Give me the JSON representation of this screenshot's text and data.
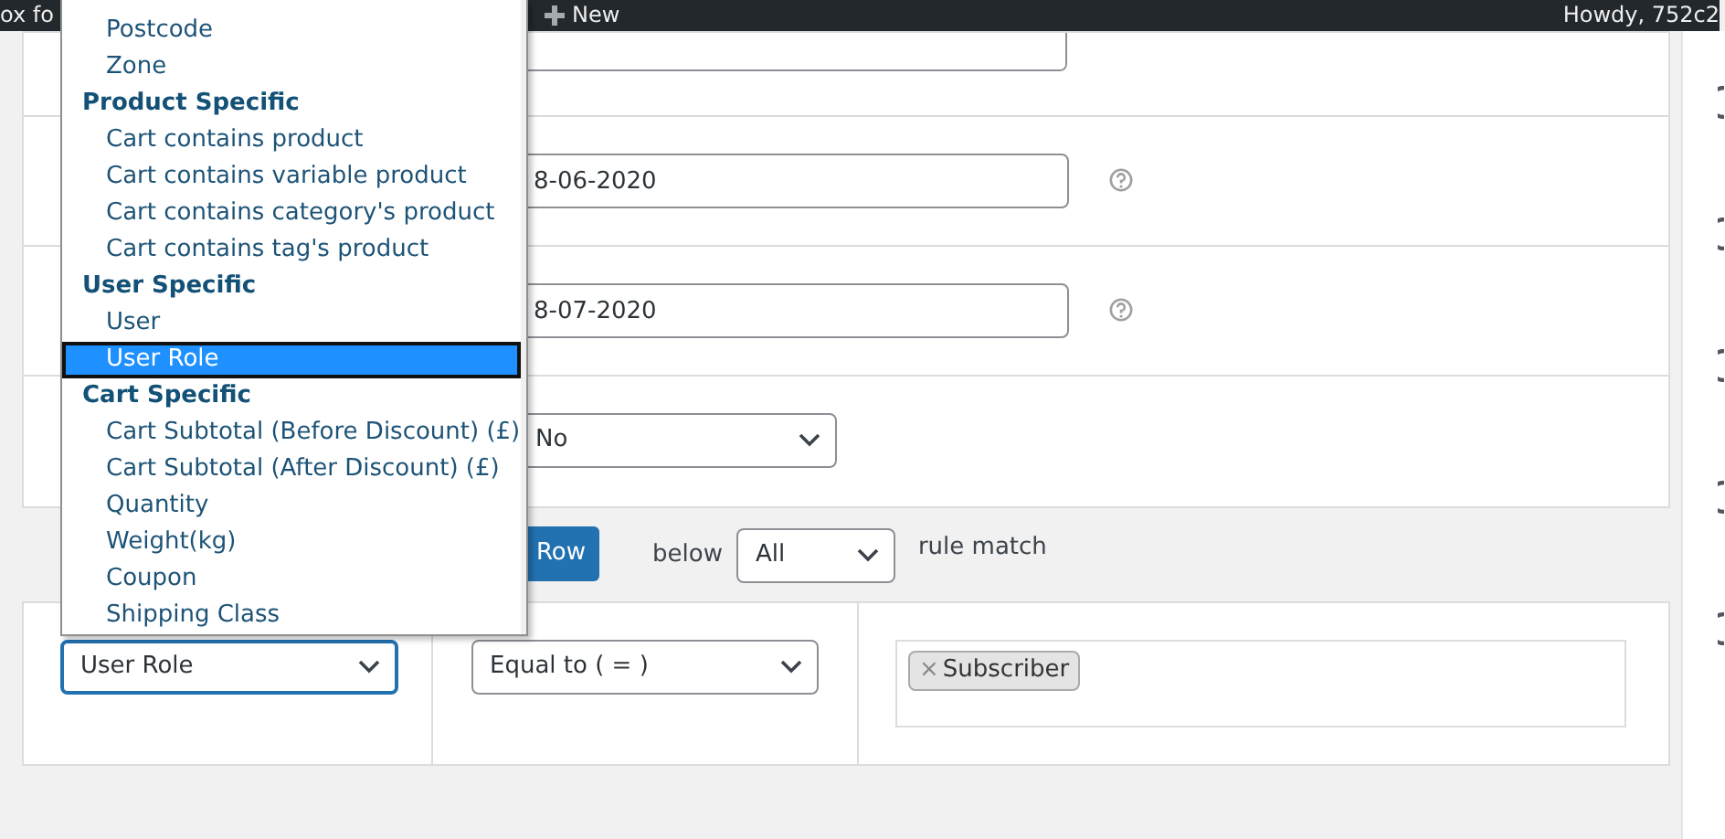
{
  "admin_bar": {
    "site_name": "ox fo",
    "new_label": "New",
    "greeting": "Howdy, 752c2"
  },
  "settings_rows": [
    {
      "kind": "textarea",
      "value": ""
    },
    {
      "kind": "date",
      "value": "8-06-2020",
      "help": true
    },
    {
      "kind": "date",
      "value": "8-07-2020",
      "help": true
    },
    {
      "kind": "select",
      "value": "No"
    }
  ],
  "conditions_header": {
    "add_button": "Row",
    "below_label": "below",
    "match_select": "All",
    "match_suffix": "rule match"
  },
  "condition_row": {
    "type_select": "User Role",
    "type_focused": true,
    "operator_select": "Equal to ( = )",
    "values": [
      {
        "label": "Subscriber",
        "remove": "×"
      }
    ]
  },
  "type_dropdown": {
    "items": [
      {
        "kind": "option",
        "label": "Postcode",
        "selected": false
      },
      {
        "kind": "option",
        "label": "Zone",
        "selected": false
      },
      {
        "kind": "group",
        "label": "Product Specific"
      },
      {
        "kind": "option",
        "label": "Cart contains product",
        "selected": false
      },
      {
        "kind": "option",
        "label": "Cart contains variable product",
        "selected": false
      },
      {
        "kind": "option",
        "label": "Cart contains category's product",
        "selected": false
      },
      {
        "kind": "option",
        "label": "Cart contains tag's product",
        "selected": false
      },
      {
        "kind": "group",
        "label": "User Specific"
      },
      {
        "kind": "option",
        "label": "User",
        "selected": false
      },
      {
        "kind": "option",
        "label": "User Role",
        "selected": true
      },
      {
        "kind": "group",
        "label": "Cart Specific"
      },
      {
        "kind": "option",
        "label": "Cart Subtotal (Before Discount) (£)",
        "selected": false
      },
      {
        "kind": "option",
        "label": "Cart Subtotal (After Discount) (£)",
        "selected": false
      },
      {
        "kind": "option",
        "label": "Quantity",
        "selected": false
      },
      {
        "kind": "option",
        "label": "Weight(kg)",
        "selected": false
      },
      {
        "kind": "option",
        "label": "Coupon",
        "selected": false
      },
      {
        "kind": "option",
        "label": "Shipping Class",
        "selected": false
      }
    ]
  }
}
